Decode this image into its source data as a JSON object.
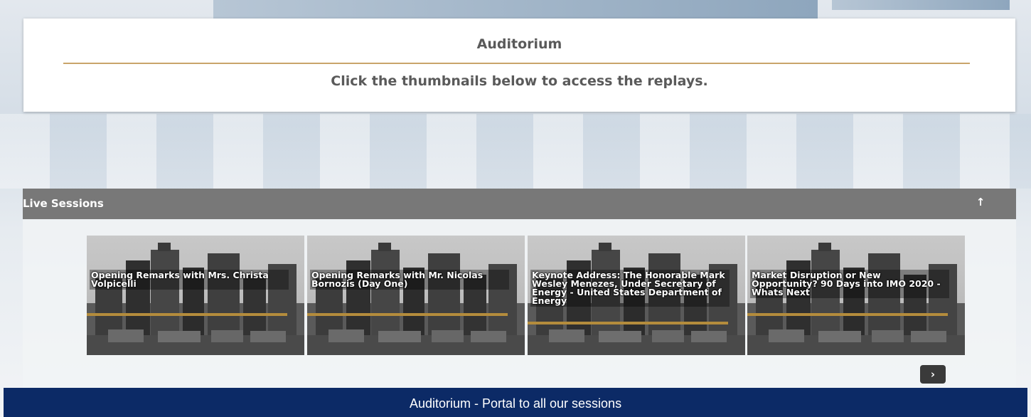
{
  "header": {
    "title": "Auditorium",
    "subtitle": "Click the thumbnails below to access the replays."
  },
  "section": {
    "title": "Live Sessions",
    "toggle_icon": "↑"
  },
  "sessions": [
    {
      "label": "Opening Remarks with Mrs. Christa Volpicelli"
    },
    {
      "label": "Opening Remarks with Mr. Nicolas Bornozis (Day One)"
    },
    {
      "label": "Keynote Address: The Honorable Mark Wesley Menezes, Under Secretary of Energy - United States Department of Energy"
    },
    {
      "label": "Market Disruption or New Opportunity? 90 Days into IMO 2020 - Whats Next"
    }
  ],
  "carousel": {
    "next_icon": "›"
  },
  "footer": {
    "text": "Auditorium - Portal to all our sessions"
  },
  "colors": {
    "accent_gold": "#c9a46a",
    "section_bar": "#787878",
    "footer_bg": "#0c2a66"
  }
}
